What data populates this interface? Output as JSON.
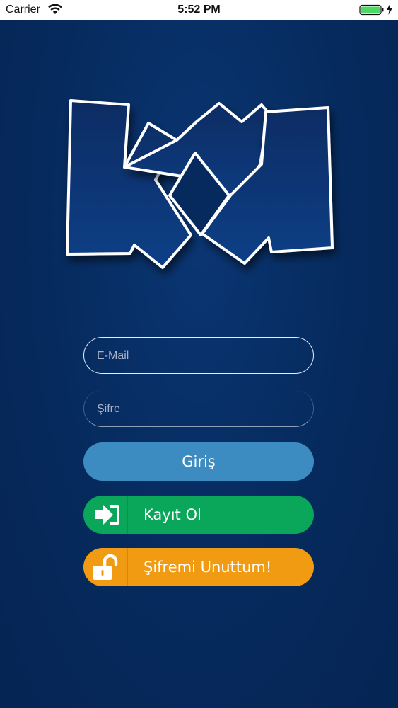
{
  "status_bar": {
    "carrier": "Carrier",
    "time": "5:52 PM",
    "battery_color": "#4cd964"
  },
  "colors": {
    "background": "#06295c",
    "login_button": "#3d8cc1",
    "register_button": "#0aa65a",
    "forgot_button": "#f19b12"
  },
  "form": {
    "email_placeholder": "E-Mail",
    "password_placeholder": "Şifre"
  },
  "buttons": {
    "login_label": "Giriş",
    "register_label": "Kayıt Ol",
    "register_icon": "sign-in-icon",
    "forgot_label": "Şifremi Unuttum!",
    "forgot_icon": "unlock-icon"
  }
}
